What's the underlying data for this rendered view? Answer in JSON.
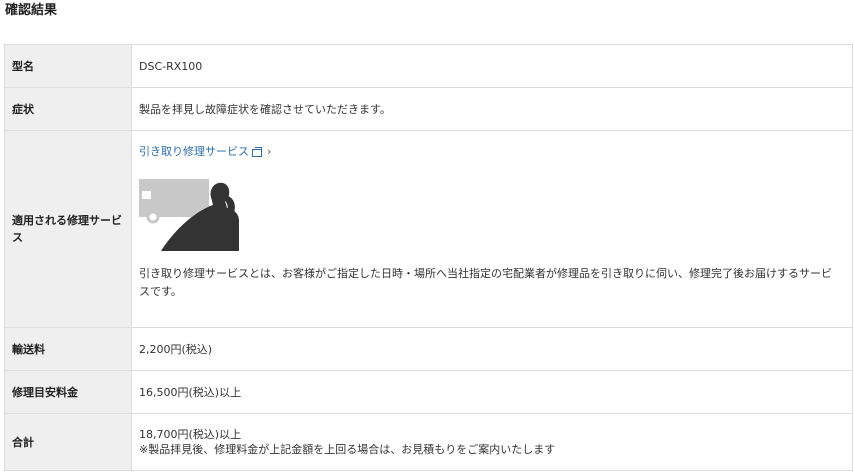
{
  "page": {
    "title": "確認結果"
  },
  "rows": {
    "model": {
      "label": "型名",
      "value": "DSC-RX100"
    },
    "symptom": {
      "label": "症状",
      "value": "製品を拝見し故障症状を確認させていただきます。"
    },
    "service": {
      "label": "適用される修理サービス",
      "link_text": "引き取り修理サービス",
      "link_icon": "external-link-icon",
      "chevron": "›",
      "illustration": "pickup-truck-and-courier-illustration",
      "description": "引き取り修理サービスとは、お客様がご指定した日時・場所へ当社指定の宅配業者が修理品を引き取りに伺い、修理完了後お届けするサービスです。"
    },
    "shipping": {
      "label": "輸送料",
      "value": "2,200円(税込)"
    },
    "estimate": {
      "label": "修理目安料金",
      "value": "16,500円(税込)以上"
    },
    "total": {
      "label": "合計",
      "value": "18,700円(税込)以上",
      "note": "※製品拝見後、修理料金が上記金額を上回る場合は、お見積もりをご案内いたします"
    }
  },
  "colors": {
    "label_bg": "#efefef",
    "border": "#dcdcdc",
    "link": "#2b6fb3",
    "illustration_truck": "#c8c8c8",
    "illustration_person": "#333333"
  }
}
